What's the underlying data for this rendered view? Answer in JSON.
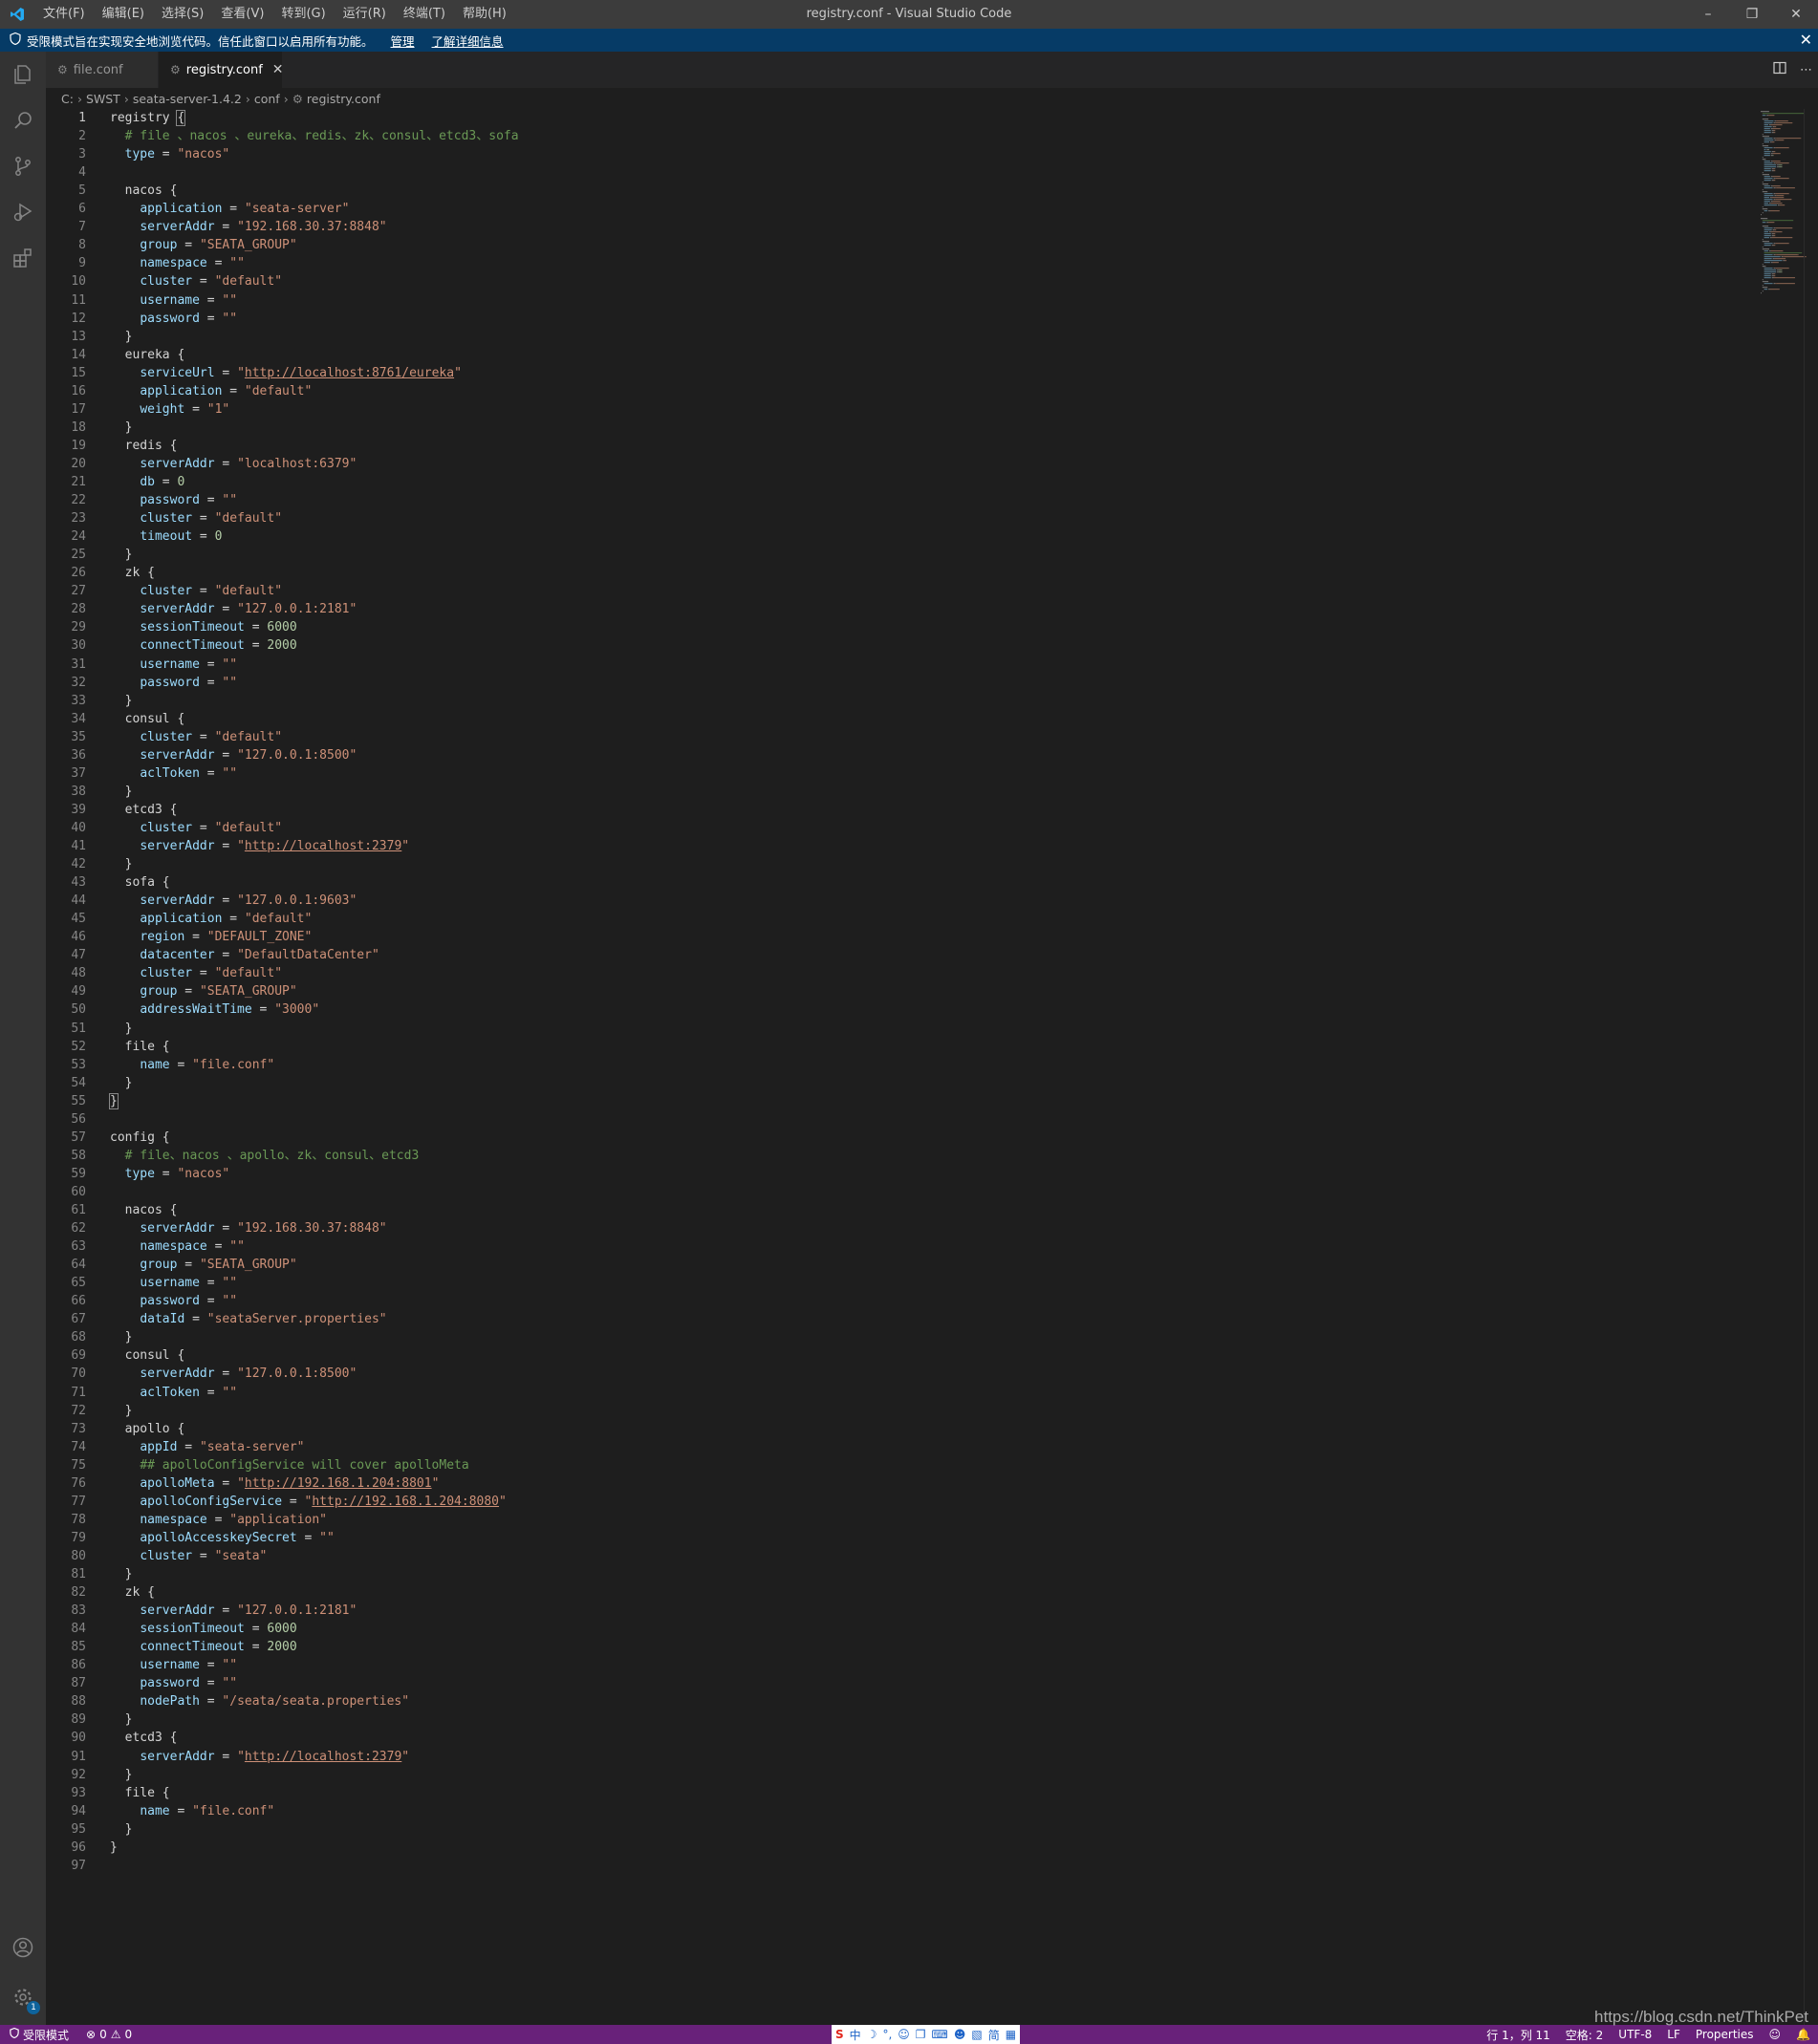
{
  "window": {
    "title": "registry.conf - Visual Studio Code",
    "menu": [
      "文件(F)",
      "编辑(E)",
      "选择(S)",
      "查看(V)",
      "转到(G)",
      "运行(R)",
      "终端(T)",
      "帮助(H)"
    ]
  },
  "banner": {
    "text": "受限模式旨在实现安全地浏览代码。信任此窗口以启用所有功能。",
    "manage": "管理",
    "learn_more": "了解详细信息"
  },
  "tabs": [
    {
      "label": "file.conf"
    },
    {
      "label": "registry.conf"
    }
  ],
  "breadcrumb": [
    "C:",
    "SWST",
    "seata-server-1.4.2",
    "conf",
    "registry.conf"
  ],
  "code": [
    [
      [
        "p",
        "registry "
      ],
      [
        "b",
        "{"
      ]
    ],
    [
      [
        "p",
        "  "
      ],
      [
        "c",
        "# file 、nacos 、eureka、redis、zk、consul、etcd3、sofa"
      ]
    ],
    [
      [
        "p",
        "  "
      ],
      [
        "k",
        "type"
      ],
      [
        "p",
        " = "
      ],
      [
        "s",
        "\"nacos\""
      ]
    ],
    [],
    [
      [
        "p",
        "  nacos {"
      ]
    ],
    [
      [
        "p",
        "    "
      ],
      [
        "k",
        "application"
      ],
      [
        "p",
        " = "
      ],
      [
        "s",
        "\"seata-server\""
      ]
    ],
    [
      [
        "p",
        "    "
      ],
      [
        "k",
        "serverAddr"
      ],
      [
        "p",
        " = "
      ],
      [
        "s",
        "\"192.168.30.37:8848\""
      ]
    ],
    [
      [
        "p",
        "    "
      ],
      [
        "k",
        "group"
      ],
      [
        "p",
        " = "
      ],
      [
        "s",
        "\"SEATA_GROUP\""
      ]
    ],
    [
      [
        "p",
        "    "
      ],
      [
        "k",
        "namespace"
      ],
      [
        "p",
        " = "
      ],
      [
        "s",
        "\"\""
      ]
    ],
    [
      [
        "p",
        "    "
      ],
      [
        "k",
        "cluster"
      ],
      [
        "p",
        " = "
      ],
      [
        "s",
        "\"default\""
      ]
    ],
    [
      [
        "p",
        "    "
      ],
      [
        "k",
        "username"
      ],
      [
        "p",
        " = "
      ],
      [
        "s",
        "\"\""
      ]
    ],
    [
      [
        "p",
        "    "
      ],
      [
        "k",
        "password"
      ],
      [
        "p",
        " = "
      ],
      [
        "s",
        "\"\""
      ]
    ],
    [
      [
        "p",
        "  }"
      ]
    ],
    [
      [
        "p",
        "  eureka {"
      ]
    ],
    [
      [
        "p",
        "    "
      ],
      [
        "k",
        "serviceUrl"
      ],
      [
        "p",
        " = "
      ],
      [
        "s",
        "\""
      ],
      [
        "u",
        "http://localhost:8761/eureka"
      ],
      [
        "s",
        "\""
      ]
    ],
    [
      [
        "p",
        "    "
      ],
      [
        "k",
        "application"
      ],
      [
        "p",
        " = "
      ],
      [
        "s",
        "\"default\""
      ]
    ],
    [
      [
        "p",
        "    "
      ],
      [
        "k",
        "weight"
      ],
      [
        "p",
        " = "
      ],
      [
        "s",
        "\"1\""
      ]
    ],
    [
      [
        "p",
        "  }"
      ]
    ],
    [
      [
        "p",
        "  redis {"
      ]
    ],
    [
      [
        "p",
        "    "
      ],
      [
        "k",
        "serverAddr"
      ],
      [
        "p",
        " = "
      ],
      [
        "s",
        "\"localhost:6379\""
      ]
    ],
    [
      [
        "p",
        "    "
      ],
      [
        "k",
        "db"
      ],
      [
        "p",
        " = "
      ],
      [
        "n",
        "0"
      ]
    ],
    [
      [
        "p",
        "    "
      ],
      [
        "k",
        "password"
      ],
      [
        "p",
        " = "
      ],
      [
        "s",
        "\"\""
      ]
    ],
    [
      [
        "p",
        "    "
      ],
      [
        "k",
        "cluster"
      ],
      [
        "p",
        " = "
      ],
      [
        "s",
        "\"default\""
      ]
    ],
    [
      [
        "p",
        "    "
      ],
      [
        "k",
        "timeout"
      ],
      [
        "p",
        " = "
      ],
      [
        "n",
        "0"
      ]
    ],
    [
      [
        "p",
        "  }"
      ]
    ],
    [
      [
        "p",
        "  zk {"
      ]
    ],
    [
      [
        "p",
        "    "
      ],
      [
        "k",
        "cluster"
      ],
      [
        "p",
        " = "
      ],
      [
        "s",
        "\"default\""
      ]
    ],
    [
      [
        "p",
        "    "
      ],
      [
        "k",
        "serverAddr"
      ],
      [
        "p",
        " = "
      ],
      [
        "s",
        "\"127.0.0.1:2181\""
      ]
    ],
    [
      [
        "p",
        "    "
      ],
      [
        "k",
        "sessionTimeout"
      ],
      [
        "p",
        " = "
      ],
      [
        "n",
        "6000"
      ]
    ],
    [
      [
        "p",
        "    "
      ],
      [
        "k",
        "connectTimeout"
      ],
      [
        "p",
        " = "
      ],
      [
        "n",
        "2000"
      ]
    ],
    [
      [
        "p",
        "    "
      ],
      [
        "k",
        "username"
      ],
      [
        "p",
        " = "
      ],
      [
        "s",
        "\"\""
      ]
    ],
    [
      [
        "p",
        "    "
      ],
      [
        "k",
        "password"
      ],
      [
        "p",
        " = "
      ],
      [
        "s",
        "\"\""
      ]
    ],
    [
      [
        "p",
        "  }"
      ]
    ],
    [
      [
        "p",
        "  consul {"
      ]
    ],
    [
      [
        "p",
        "    "
      ],
      [
        "k",
        "cluster"
      ],
      [
        "p",
        " = "
      ],
      [
        "s",
        "\"default\""
      ]
    ],
    [
      [
        "p",
        "    "
      ],
      [
        "k",
        "serverAddr"
      ],
      [
        "p",
        " = "
      ],
      [
        "s",
        "\"127.0.0.1:8500\""
      ]
    ],
    [
      [
        "p",
        "    "
      ],
      [
        "k",
        "aclToken"
      ],
      [
        "p",
        " = "
      ],
      [
        "s",
        "\"\""
      ]
    ],
    [
      [
        "p",
        "  }"
      ]
    ],
    [
      [
        "p",
        "  etcd3 {"
      ]
    ],
    [
      [
        "p",
        "    "
      ],
      [
        "k",
        "cluster"
      ],
      [
        "p",
        " = "
      ],
      [
        "s",
        "\"default\""
      ]
    ],
    [
      [
        "p",
        "    "
      ],
      [
        "k",
        "serverAddr"
      ],
      [
        "p",
        " = "
      ],
      [
        "s",
        "\""
      ],
      [
        "u",
        "http://localhost:2379"
      ],
      [
        "s",
        "\""
      ]
    ],
    [
      [
        "p",
        "  }"
      ]
    ],
    [
      [
        "p",
        "  sofa {"
      ]
    ],
    [
      [
        "p",
        "    "
      ],
      [
        "k",
        "serverAddr"
      ],
      [
        "p",
        " = "
      ],
      [
        "s",
        "\"127.0.0.1:9603\""
      ]
    ],
    [
      [
        "p",
        "    "
      ],
      [
        "k",
        "application"
      ],
      [
        "p",
        " = "
      ],
      [
        "s",
        "\"default\""
      ]
    ],
    [
      [
        "p",
        "    "
      ],
      [
        "k",
        "region"
      ],
      [
        "p",
        " = "
      ],
      [
        "s",
        "\"DEFAULT_ZONE\""
      ]
    ],
    [
      [
        "p",
        "    "
      ],
      [
        "k",
        "datacenter"
      ],
      [
        "p",
        " = "
      ],
      [
        "s",
        "\"DefaultDataCenter\""
      ]
    ],
    [
      [
        "p",
        "    "
      ],
      [
        "k",
        "cluster"
      ],
      [
        "p",
        " = "
      ],
      [
        "s",
        "\"default\""
      ]
    ],
    [
      [
        "p",
        "    "
      ],
      [
        "k",
        "group"
      ],
      [
        "p",
        " = "
      ],
      [
        "s",
        "\"SEATA_GROUP\""
      ]
    ],
    [
      [
        "p",
        "    "
      ],
      [
        "k",
        "addressWaitTime"
      ],
      [
        "p",
        " = "
      ],
      [
        "s",
        "\"3000\""
      ]
    ],
    [
      [
        "p",
        "  }"
      ]
    ],
    [
      [
        "p",
        "  file {"
      ]
    ],
    [
      [
        "p",
        "    "
      ],
      [
        "k",
        "name"
      ],
      [
        "p",
        " = "
      ],
      [
        "s",
        "\"file.conf\""
      ]
    ],
    [
      [
        "p",
        "  }"
      ]
    ],
    [
      [
        "b",
        "}"
      ]
    ],
    [],
    [
      [
        "p",
        "config {"
      ]
    ],
    [
      [
        "p",
        "  "
      ],
      [
        "c",
        "# file、nacos 、apollo、zk、consul、etcd3"
      ]
    ],
    [
      [
        "p",
        "  "
      ],
      [
        "k",
        "type"
      ],
      [
        "p",
        " = "
      ],
      [
        "s",
        "\"nacos\""
      ]
    ],
    [],
    [
      [
        "p",
        "  nacos {"
      ]
    ],
    [
      [
        "p",
        "    "
      ],
      [
        "k",
        "serverAddr"
      ],
      [
        "p",
        " = "
      ],
      [
        "s",
        "\"192.168.30.37:8848\""
      ]
    ],
    [
      [
        "p",
        "    "
      ],
      [
        "k",
        "namespace"
      ],
      [
        "p",
        " = "
      ],
      [
        "s",
        "\"\""
      ]
    ],
    [
      [
        "p",
        "    "
      ],
      [
        "k",
        "group"
      ],
      [
        "p",
        " = "
      ],
      [
        "s",
        "\"SEATA_GROUP\""
      ]
    ],
    [
      [
        "p",
        "    "
      ],
      [
        "k",
        "username"
      ],
      [
        "p",
        " = "
      ],
      [
        "s",
        "\"\""
      ]
    ],
    [
      [
        "p",
        "    "
      ],
      [
        "k",
        "password"
      ],
      [
        "p",
        " = "
      ],
      [
        "s",
        "\"\""
      ]
    ],
    [
      [
        "p",
        "    "
      ],
      [
        "k",
        "dataId"
      ],
      [
        "p",
        " = "
      ],
      [
        "s",
        "\"seataServer.properties\""
      ]
    ],
    [
      [
        "p",
        "  }"
      ]
    ],
    [
      [
        "p",
        "  consul {"
      ]
    ],
    [
      [
        "p",
        "    "
      ],
      [
        "k",
        "serverAddr"
      ],
      [
        "p",
        " = "
      ],
      [
        "s",
        "\"127.0.0.1:8500\""
      ]
    ],
    [
      [
        "p",
        "    "
      ],
      [
        "k",
        "aclToken"
      ],
      [
        "p",
        " = "
      ],
      [
        "s",
        "\"\""
      ]
    ],
    [
      [
        "p",
        "  }"
      ]
    ],
    [
      [
        "p",
        "  apollo {"
      ]
    ],
    [
      [
        "p",
        "    "
      ],
      [
        "k",
        "appId"
      ],
      [
        "p",
        " = "
      ],
      [
        "s",
        "\"seata-server\""
      ]
    ],
    [
      [
        "p",
        "    "
      ],
      [
        "c",
        "## apolloConfigService will cover apolloMeta"
      ]
    ],
    [
      [
        "p",
        "    "
      ],
      [
        "k",
        "apolloMeta"
      ],
      [
        "p",
        " = "
      ],
      [
        "s",
        "\""
      ],
      [
        "u",
        "http://192.168.1.204:8801"
      ],
      [
        "s",
        "\""
      ]
    ],
    [
      [
        "p",
        "    "
      ],
      [
        "k",
        "apolloConfigService"
      ],
      [
        "p",
        " = "
      ],
      [
        "s",
        "\""
      ],
      [
        "u",
        "http://192.168.1.204:8080"
      ],
      [
        "s",
        "\""
      ]
    ],
    [
      [
        "p",
        "    "
      ],
      [
        "k",
        "namespace"
      ],
      [
        "p",
        " = "
      ],
      [
        "s",
        "\"application\""
      ]
    ],
    [
      [
        "p",
        "    "
      ],
      [
        "k",
        "apolloAccesskeySecret"
      ],
      [
        "p",
        " = "
      ],
      [
        "s",
        "\"\""
      ]
    ],
    [
      [
        "p",
        "    "
      ],
      [
        "k",
        "cluster"
      ],
      [
        "p",
        " = "
      ],
      [
        "s",
        "\"seata\""
      ]
    ],
    [
      [
        "p",
        "  }"
      ]
    ],
    [
      [
        "p",
        "  zk {"
      ]
    ],
    [
      [
        "p",
        "    "
      ],
      [
        "k",
        "serverAddr"
      ],
      [
        "p",
        " = "
      ],
      [
        "s",
        "\"127.0.0.1:2181\""
      ]
    ],
    [
      [
        "p",
        "    "
      ],
      [
        "k",
        "sessionTimeout"
      ],
      [
        "p",
        " = "
      ],
      [
        "n",
        "6000"
      ]
    ],
    [
      [
        "p",
        "    "
      ],
      [
        "k",
        "connectTimeout"
      ],
      [
        "p",
        " = "
      ],
      [
        "n",
        "2000"
      ]
    ],
    [
      [
        "p",
        "    "
      ],
      [
        "k",
        "username"
      ],
      [
        "p",
        " = "
      ],
      [
        "s",
        "\"\""
      ]
    ],
    [
      [
        "p",
        "    "
      ],
      [
        "k",
        "password"
      ],
      [
        "p",
        " = "
      ],
      [
        "s",
        "\"\""
      ]
    ],
    [
      [
        "p",
        "    "
      ],
      [
        "k",
        "nodePath"
      ],
      [
        "p",
        " = "
      ],
      [
        "s",
        "\"/seata/seata.properties\""
      ]
    ],
    [
      [
        "p",
        "  }"
      ]
    ],
    [
      [
        "p",
        "  etcd3 {"
      ]
    ],
    [
      [
        "p",
        "    "
      ],
      [
        "k",
        "serverAddr"
      ],
      [
        "p",
        " = "
      ],
      [
        "s",
        "\""
      ],
      [
        "u",
        "http://localhost:2379"
      ],
      [
        "s",
        "\""
      ]
    ],
    [
      [
        "p",
        "  }"
      ]
    ],
    [
      [
        "p",
        "  file {"
      ]
    ],
    [
      [
        "p",
        "    "
      ],
      [
        "k",
        "name"
      ],
      [
        "p",
        " = "
      ],
      [
        "s",
        "\"file.conf\""
      ]
    ],
    [
      [
        "p",
        "  }"
      ]
    ],
    [
      [
        "p",
        "}"
      ]
    ],
    []
  ],
  "statusbar": {
    "restricted": "受限模式",
    "errors": "0",
    "warnings": "0",
    "position": "行 1，列 11",
    "spaces": "空格: 2",
    "encoding": "UTF-8",
    "eol": "LF",
    "language": "Properties"
  },
  "ime": [
    "中",
    "简"
  ],
  "watermark": "https://blog.csdn.net/ThinkPet",
  "colors": {
    "statusbar": "#68217a",
    "banner": "#063b66",
    "keyword": "#9cdcfe",
    "string": "#ce9178",
    "comment": "#6a9955",
    "number": "#b5cea8"
  }
}
